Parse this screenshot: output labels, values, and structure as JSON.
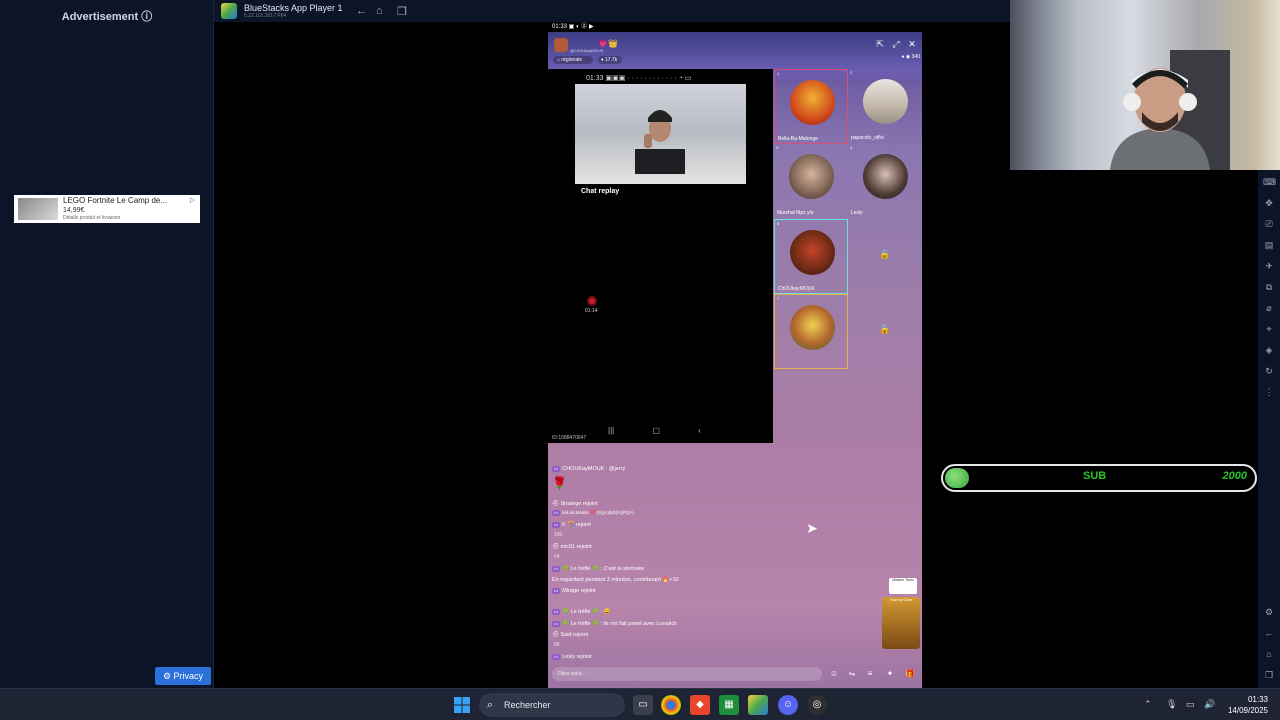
{
  "ad": {
    "title": "Advertisement",
    "product_name": "LEGO Fortnite Le Camp de...",
    "price": "14,99€",
    "note": "Détails produit et livraison",
    "privacy_label": "Privacy"
  },
  "bluestacks": {
    "title": "BlueStacks App Player 1",
    "version": "5.22.101.2017 P64"
  },
  "phone": {
    "status_time": "01:33",
    "room_sub": "@ChOUkayMOUK",
    "room_tag": "régionale",
    "room_count": "17.7k",
    "viewers": "340",
    "inner_time": "01:33",
    "chat_replay": "Chat replay",
    "rec_time": "01:14",
    "stream_id": "ID:1088470647",
    "seats": [
      {
        "num": "1",
        "name": "Bella-Ba-Matonge"
      },
      {
        "num": "2",
        "name": "papacolo_offici"
      },
      {
        "num": "3",
        "name": "Marshal Mpz yts"
      },
      {
        "num": "4",
        "name": "Lesly"
      },
      {
        "num": "5",
        "name": "ChOUkayMOUK"
      },
      {
        "num": "7",
        "name": "…"
      }
    ],
    "chat": [
      {
        "tag": "Lv",
        "text": "CHOUKayMOUK : @jerry"
      },
      {
        "tag": "",
        "text": "Stratege rejoint"
      },
      {
        "tag": "Lv",
        "text": "kal.de.Manila 💯 (S)(A)(M)(A)(R)(A)"
      },
      {
        "tag": "Lv",
        "text": "k' 🎊 rejoint"
      },
      {
        "tag": "",
        "text": "mic91 rejoint"
      },
      {
        "tag": "Lv",
        "text": "🍀 Le trèfle 🍀 : C'est la sternake"
      },
      {
        "tag": "",
        "text": "En regardant pendant 3 minutes, contribuant  🔥+10"
      },
      {
        "tag": "Lv",
        "text": "Mirage rejoint"
      },
      {
        "tag": "Lv",
        "text": "🍀 Le trèfle 🍀 : 😄"
      },
      {
        "tag": "Lv",
        "text": "🍀 Le trèfle 🍀 : ils ont fait pareil avec Lunatick"
      },
      {
        "tag": "",
        "text": "Said rejoint"
      },
      {
        "tag": "Lv",
        "text": "Lesly rejoint"
      }
    ],
    "like_counts": [
      "100",
      "64",
      "68"
    ],
    "input_placeholder": "Dites salut...",
    "event_label": "Tournoi Clan",
    "event_top": "Mission Team"
  },
  "goal": {
    "label": "SUB",
    "target": "2000",
    "progress": 0
  },
  "taskbar": {
    "search_label": "Rechercher",
    "time": "01:33",
    "date": "14/09/2025"
  }
}
